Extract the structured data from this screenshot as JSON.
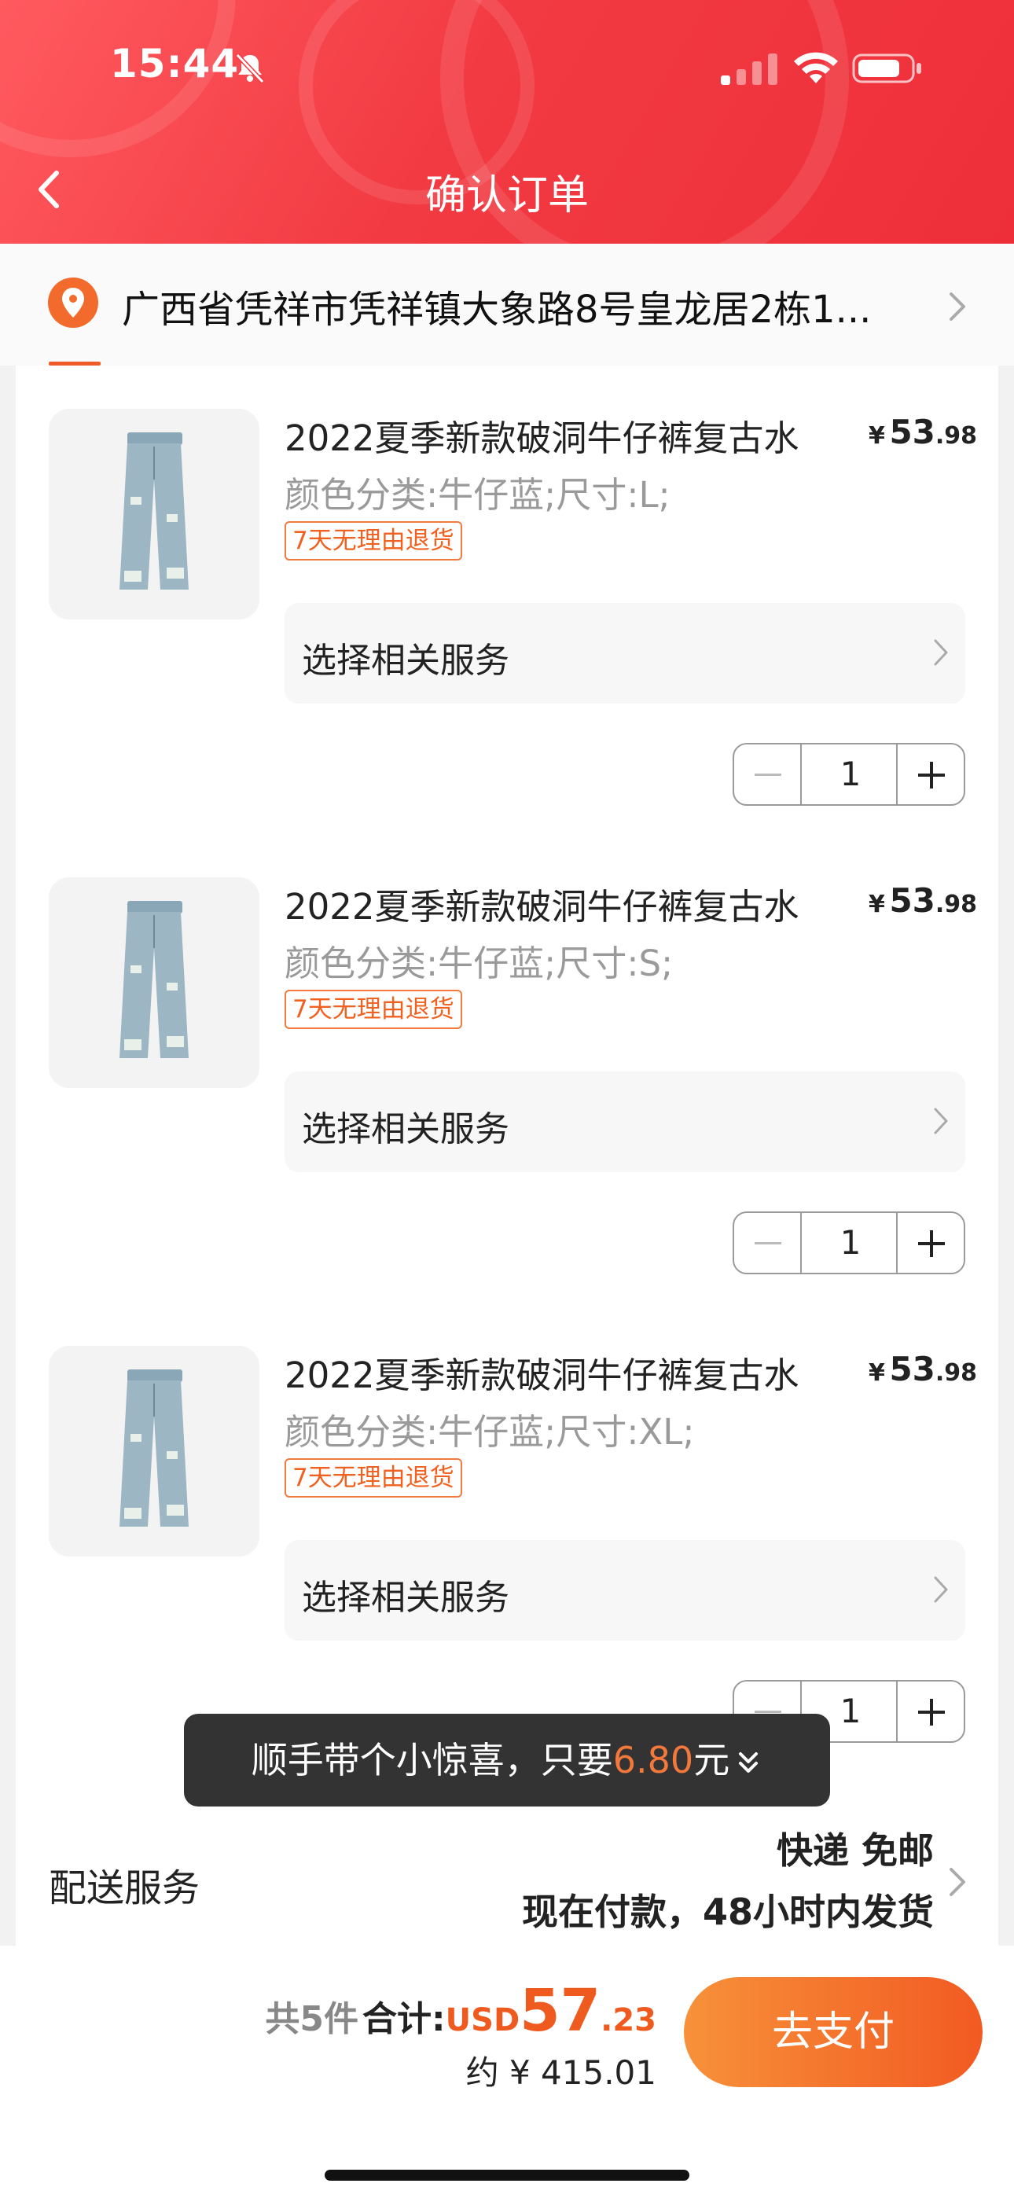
{
  "status_bar": {
    "time": "15:44"
  },
  "header": {
    "title": "确认订单"
  },
  "address": {
    "text": "广西省凭祥市凭祥镇大象路8号皇龙居2栋1..."
  },
  "items": [
    {
      "name": "2022夏季新款破洞牛仔裤复古水",
      "currency": "¥",
      "price_int": "53",
      "price_dec": ".98",
      "spec": "颜色分类:牛仔蓝;尺寸:L;",
      "tag": "7天无理由退货",
      "service_label": "选择相关服务",
      "quantity": "1"
    },
    {
      "name": "2022夏季新款破洞牛仔裤复古水",
      "currency": "¥",
      "price_int": "53",
      "price_dec": ".98",
      "spec": "颜色分类:牛仔蓝;尺寸:S;",
      "tag": "7天无理由退货",
      "service_label": "选择相关服务",
      "quantity": "1"
    },
    {
      "name": "2022夏季新款破洞牛仔裤复古水",
      "currency": "¥",
      "price_int": "53",
      "price_dec": ".98",
      "spec": "颜色分类:牛仔蓝;尺寸:XL;",
      "tag": "7天无理由退货",
      "service_label": "选择相关服务",
      "quantity": "1"
    }
  ],
  "toast": {
    "prefix": "顺手带个小惊喜，只要",
    "amount": "6.80",
    "suffix": "元"
  },
  "delivery": {
    "label": "配送服务",
    "line1": "快递 免邮",
    "line2": "现在付款，48小时内发货"
  },
  "footer": {
    "count": "共5件",
    "total_label": "合计:",
    "currency": "USD",
    "total_int": "57",
    "total_dec": ".23",
    "approx": "约 ¥ 415.01",
    "pay_label": "去支付"
  },
  "colors": {
    "header_red": "#f23a42",
    "accent_orange": "#f05a28",
    "toast_bg": "#333333"
  }
}
